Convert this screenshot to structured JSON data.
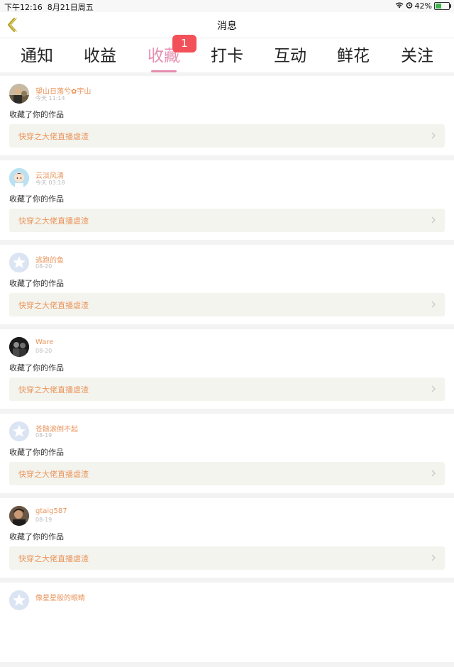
{
  "status": {
    "time": "下午12:16",
    "date": "8月21日周五",
    "battery": "42%",
    "battery_level": 0.42
  },
  "nav": {
    "title": "消息"
  },
  "tabs": [
    {
      "label": "通知"
    },
    {
      "label": "收益"
    },
    {
      "label": "收藏",
      "active": true,
      "badge": "1"
    },
    {
      "label": "打卡"
    },
    {
      "label": "互动"
    },
    {
      "label": "鲜花"
    },
    {
      "label": "关注"
    }
  ],
  "items": [
    {
      "user": "望山日落兮✿宇山",
      "time": "今天 11:14",
      "action": "收藏了你的作品",
      "work": "快穿之大佬直播虐渣",
      "avatar": "photo-avatar"
    },
    {
      "user": "云淡风清",
      "time": "今天 03:18",
      "action": "收藏了你的作品",
      "work": "快穿之大佬直播虐渣",
      "avatar": "cartoon-avatar"
    },
    {
      "user": "逃跑的鱼",
      "time": "08-20",
      "action": "收藏了你的作品",
      "work": "快穿之大佬直播虐渣",
      "avatar": "default-star-avatar"
    },
    {
      "user": "Ware",
      "time": "08-20",
      "action": "收藏了你的作品",
      "work": "快穿之大佬直播虐渣",
      "avatar": "dark-photo-avatar"
    },
    {
      "user": "苍骸滚倒不起",
      "time": "08-19",
      "action": "收藏了你的作品",
      "work": "快穿之大佬直播虐渣",
      "avatar": "default-star-avatar"
    },
    {
      "user": "gtaig587",
      "time": "08-19",
      "action": "收藏了你的作品",
      "work": "快穿之大佬直播虐渣",
      "avatar": "photo-avatar"
    },
    {
      "user": "像星星般的眼睛",
      "time": "",
      "action": "",
      "work": "",
      "avatar": "default-star-avatar"
    }
  ]
}
